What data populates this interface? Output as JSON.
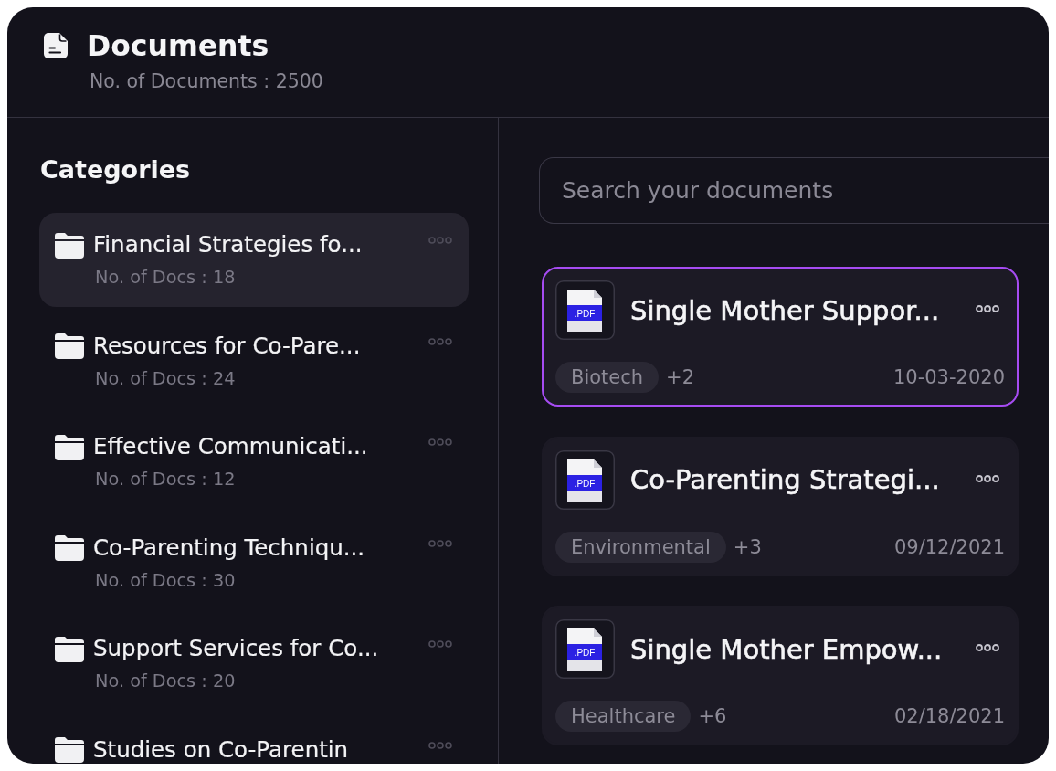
{
  "header": {
    "title": "Documents",
    "subtitle": "No. of Documents : 2500"
  },
  "categories": {
    "title": "Categories",
    "items": [
      {
        "name": "Financial Strategies fo...",
        "count": "No. of Docs : 18",
        "selected": true
      },
      {
        "name": "Resources for Co-Pare...",
        "count": "No. of Docs : 24",
        "selected": false
      },
      {
        "name": "Effective Communicati...",
        "count": "No. of Docs : 12",
        "selected": false
      },
      {
        "name": "Co-Parenting Techniqu...",
        "count": "No. of Docs : 30",
        "selected": false
      },
      {
        "name": "Support Services for Co...",
        "count": "No. of Docs : 20",
        "selected": false
      },
      {
        "name": "Studies on Co-Parentin",
        "selected": false
      }
    ]
  },
  "search": {
    "placeholder": "Search your documents"
  },
  "documents": [
    {
      "title": "Single Mother Suppor...",
      "file_type": ".PDF",
      "tag": "Biotech",
      "more_tags": "+2",
      "date": "10-03-2020",
      "selected": true
    },
    {
      "title": "Co-Parenting Strategi...",
      "file_type": ".PDF",
      "tag": "Environmental",
      "more_tags": "+3",
      "date": "09/12/2021",
      "selected": false
    },
    {
      "title": "Single Mother Empow...",
      "file_type": ".PDF",
      "tag": "Healthcare",
      "more_tags": "+6",
      "date": "02/18/2021",
      "selected": false
    }
  ]
}
